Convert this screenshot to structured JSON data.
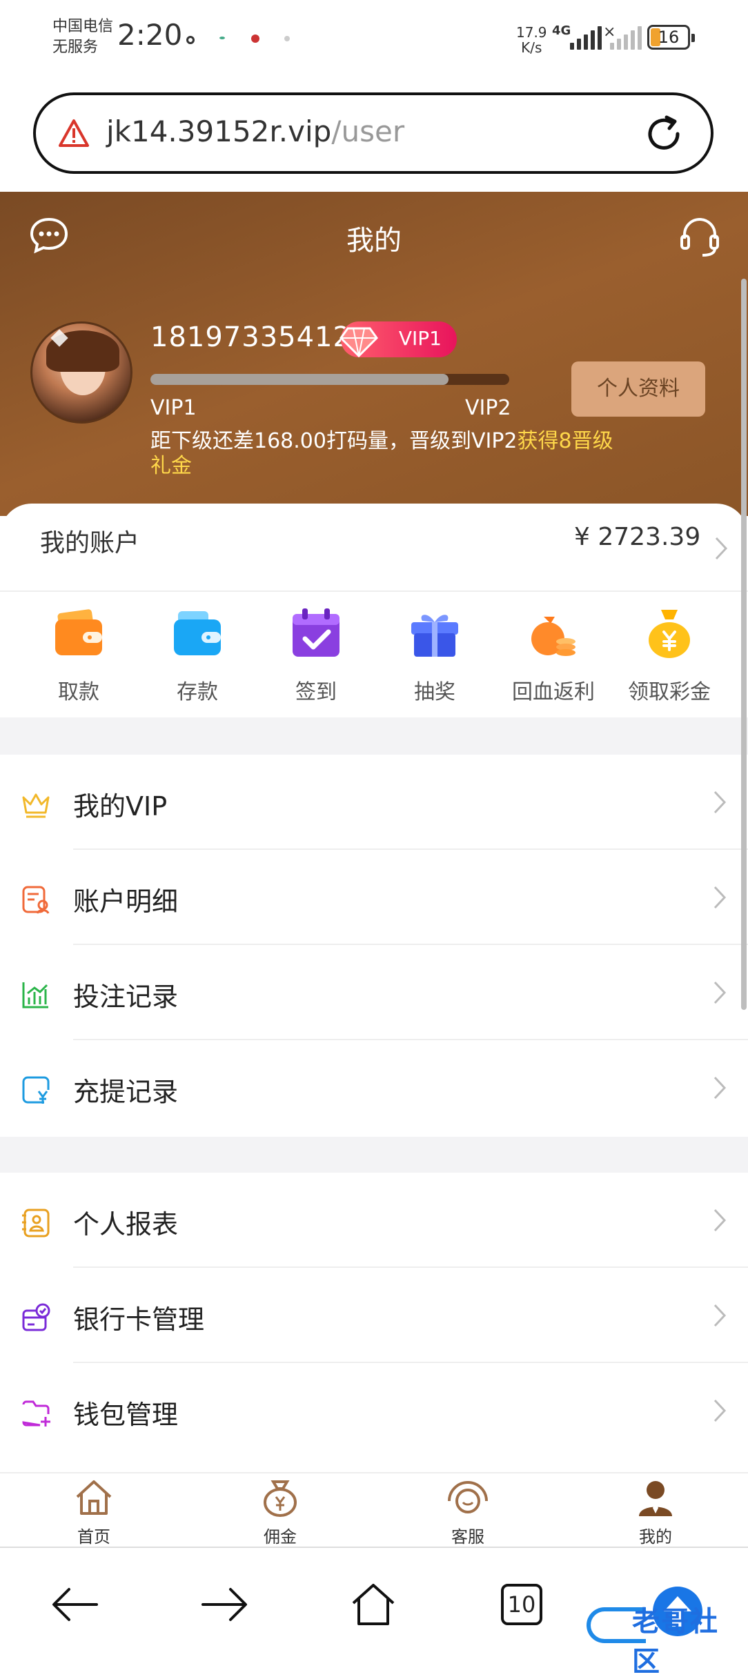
{
  "status_bar": {
    "carrier_line1": "中国电信",
    "carrier_line2": "无服务",
    "time": "2:20",
    "net_speed_value": "17.9",
    "net_speed_unit": "K/s",
    "network_type": "4G",
    "battery": "16"
  },
  "browser": {
    "url_host": "jk14.39152r.vip",
    "url_path": "/user",
    "tab_count": "10"
  },
  "header": {
    "title": "我的"
  },
  "profile": {
    "phone": "18197335412",
    "vip_badge": "VIP1",
    "progress_fraction": 0.83,
    "level_current": "VIP1",
    "level_next": "VIP2",
    "upgrade_hint": "距下级还差168.00打码量，晋级到VIP2",
    "upgrade_reward": "获得8晋级礼金",
    "profile_button": "个人资料"
  },
  "account": {
    "label": "我的账户",
    "amount": "¥ 2723.39"
  },
  "quick_actions": [
    {
      "label": "取款",
      "icon": "wallet-orange-icon"
    },
    {
      "label": "存款",
      "icon": "wallet-blue-icon"
    },
    {
      "label": "签到",
      "icon": "calendar-check-icon"
    },
    {
      "label": "抽奖",
      "icon": "gift-box-icon"
    },
    {
      "label": "回血返利",
      "icon": "money-bag-coins-icon"
    },
    {
      "label": "领取彩金",
      "icon": "yen-bag-icon"
    }
  ],
  "menu_group1": [
    {
      "label": "我的VIP",
      "icon": "crown-icon"
    },
    {
      "label": "账户明细",
      "icon": "account-detail-icon"
    },
    {
      "label": "投注记录",
      "icon": "chart-icon"
    },
    {
      "label": "充提记录",
      "icon": "recharge-record-icon"
    }
  ],
  "menu_group2": [
    {
      "label": "个人报表",
      "icon": "report-icon"
    },
    {
      "label": "银行卡管理",
      "icon": "bank-card-icon"
    },
    {
      "label": "钱包管理",
      "icon": "wallet-folder-icon"
    }
  ],
  "tab_bar": [
    {
      "label": "首页",
      "icon": "home-icon"
    },
    {
      "label": "佣金",
      "icon": "commission-bag-icon"
    },
    {
      "label": "客服",
      "icon": "headset-icon"
    },
    {
      "label": "我的",
      "icon": "user-icon"
    }
  ],
  "watermark": "老哥社区"
}
